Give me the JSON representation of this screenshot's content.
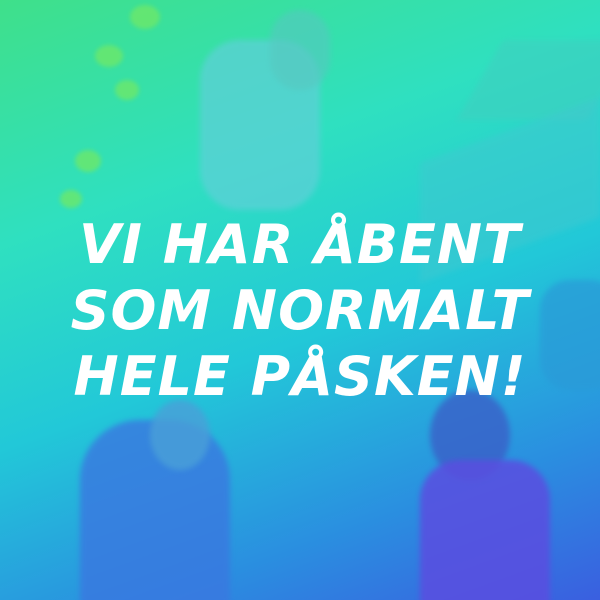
{
  "headline": {
    "lines": [
      "VI HAR ÅBENT",
      "SOM NORMALT",
      "HELE PÅSKEN!"
    ],
    "color": "#ffffff"
  },
  "background": {
    "description_colors": [
      "#3fe08a",
      "#2fe0c0",
      "#22c8d8",
      "#2a8fe0",
      "#3a5fe0"
    ]
  }
}
